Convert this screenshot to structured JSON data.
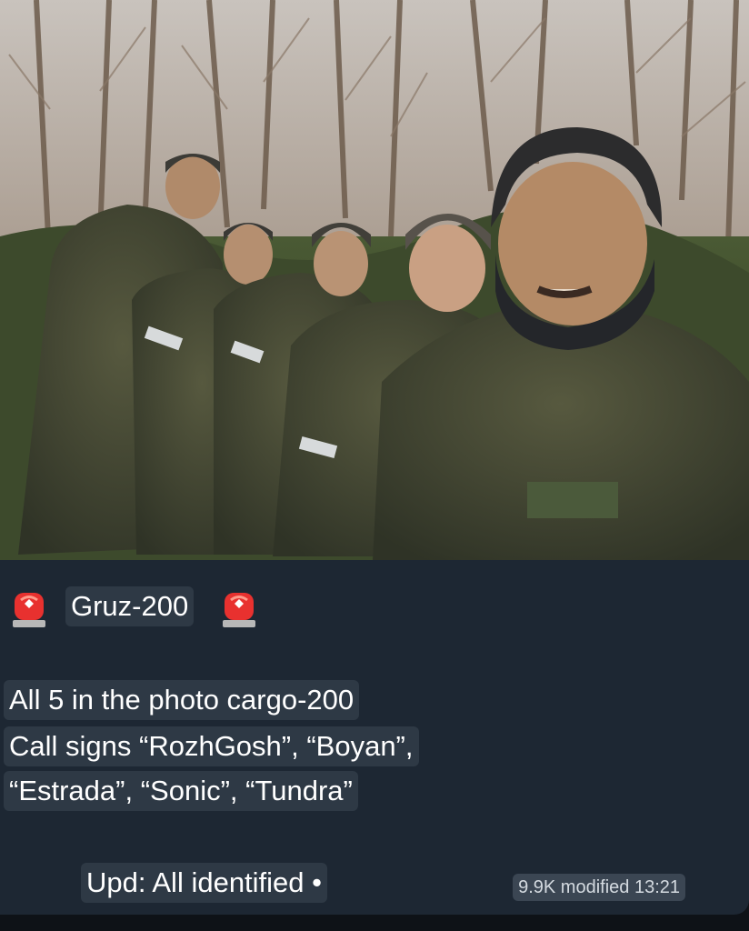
{
  "post": {
    "header_label": "Gruz-200",
    "header_icon_left": "police-siren-icon",
    "header_icon_right": "police-siren-icon",
    "lines": [
      "All 5 in the photo cargo-200",
      "Call signs “RozhGosh”, “Boyan”,",
      "“Estrada”, “Sonic”, “Tundra”"
    ],
    "update": "Upd: All identified •",
    "meta": "9.9K modified 13:21"
  },
  "colors": {
    "bubble_bg": "#1d2733",
    "chip_bg": "#2e3945",
    "text": "#ffffff",
    "siren_red": "#e8312f"
  }
}
